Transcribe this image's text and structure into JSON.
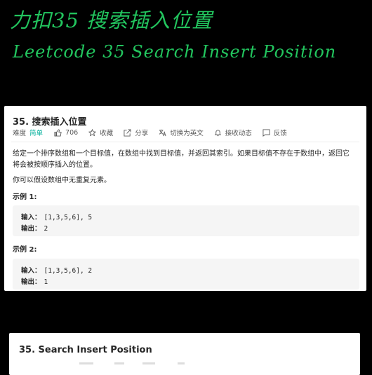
{
  "handwriting": {
    "title": "力扣35 搜索插入位置",
    "subtitle": "Leetcode 35  Search Insert Position"
  },
  "problem": {
    "title": "35. 搜索插入位置",
    "difficulty_label": "难度",
    "difficulty": "简单",
    "likes": "706",
    "favorite": "收藏",
    "share": "分享",
    "switch_en": "切换为英文",
    "notify": "接收动态",
    "feedback": "反馈",
    "description": "给定一个排序数组和一个目标值，在数组中找到目标值，并返回其索引。如果目标值不存在于数组中，返回它将会被按顺序插入的位置。",
    "assumption": "你可以假设数组中无重复元素。",
    "examples": [
      {
        "title": "示例 1:",
        "input_label": "输入：",
        "input": "[1,3,5,6], 5",
        "output_label": "输出：",
        "output": "2"
      },
      {
        "title": "示例 2:",
        "input_label": "输入：",
        "input": "[1,3,5,6], 2",
        "output_label": "输出：",
        "output": "1"
      }
    ]
  },
  "english_panel": {
    "title": "35. Search Insert Position"
  },
  "colors": {
    "handwriting": "#22c55e",
    "easy": "#00af9b"
  },
  "icons": [
    "thumb-up-icon",
    "star-icon",
    "share-icon",
    "translate-icon",
    "bell-icon",
    "feedback-icon"
  ]
}
